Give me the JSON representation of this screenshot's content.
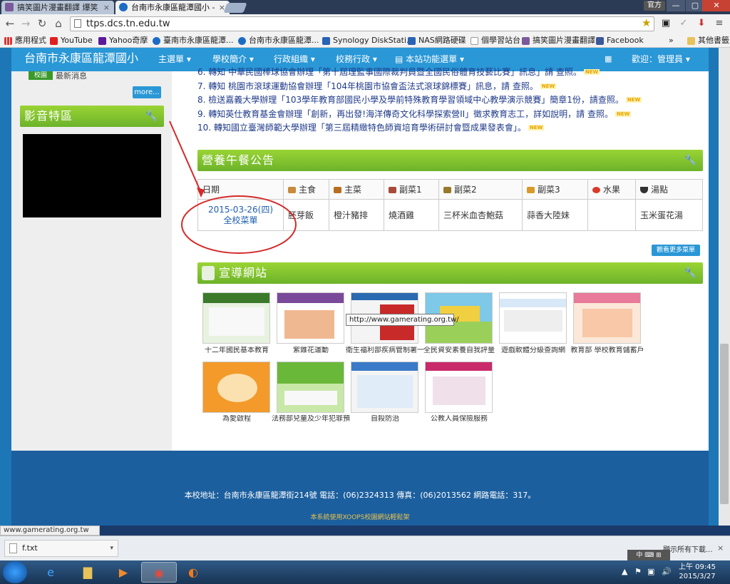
{
  "tabs": [
    {
      "label": "搞笑圖片漫畫翻譯 爆笑"
    },
    {
      "label": "台南市永康區龍潭國小 - "
    }
  ],
  "user_label": "官方",
  "url": "ttps.dcs.tn.edu.tw",
  "bookmarks": [
    "應用程式",
    "YouTube",
    "Yahoo奇摩",
    "臺南市永康區龍潭...",
    "台南市永康區龍潭...",
    "Synology DiskStati...",
    "NAS網路硬碟",
    "個學習站台",
    "搞笑圖片漫畫翻譯",
    "Facebook"
  ],
  "bookmarks_more": "»",
  "bookmarks_other": "其他書籤",
  "site": {
    "title": "台南市永康區龍潭國小",
    "nav": [
      "主選單 ▾",
      "學校簡介 ▾",
      "行政組織 ▾",
      "校務行政 ▾",
      "本站功能選單 ▾"
    ],
    "welcome": "歡迎：管理員 ▾"
  },
  "sidebar": {
    "news_badge": "校園",
    "news_text": "最新消息",
    "more": "more...",
    "video_title": "影音特區"
  },
  "news": [
    {
      "num": "6.",
      "text": "轉知 中華民國棒球協會辦理「第十屆理監事國際裁判員暨全國民俗體育技藝比賽」訊息」請 查照。",
      "new": true
    },
    {
      "num": "7.",
      "text": "轉知 桃園市滾球運動協會辦理「104年桃園市協會盃法式滾球錦標賽」訊息，請 查照。",
      "new": true
    },
    {
      "num": "8.",
      "text": "檢送嘉義大學辦理「103學年教育部國民小學及學前特殊教育學習領域中心教學演示競賽」簡章1份，請查照。",
      "new": true
    },
    {
      "num": "9.",
      "text": "轉知英仕教育基金會辦理「創新，再出發!海洋傳奇文化科學探索營II」徵求教育志工，詳如說明，請 查照。",
      "new": true
    },
    {
      "num": "10.",
      "text": "轉知國立臺灣師範大學辦理「第三屆精緻特色師資培育學術研討會暨成果發表會」。",
      "new": true
    }
  ],
  "lunch": {
    "title": "營養午餐公告",
    "headers": [
      "日期",
      "主食",
      "主菜",
      "副菜1",
      "副菜2",
      "副菜3",
      "水果",
      "湯點"
    ],
    "date": "2015-03-26(四)",
    "menu_link": "全校菜單",
    "items": [
      "胚芽飯",
      "橙汁豬排",
      "燒酒雞",
      "三杯米血杏鮑菇",
      "蒜香大陸妹",
      "",
      "玉米蛋花湯"
    ],
    "more": "觀看更多菜單"
  },
  "guide": {
    "title": "宣導網站",
    "sites": [
      {
        "label": "十二年國民基本教育"
      },
      {
        "label": "紫錐花運動"
      },
      {
        "label": "衛生福利部疾病管制署一般民眾版"
      },
      {
        "label": "全民資安素養自我評量"
      },
      {
        "label": "遊戲軟體分級查詢網"
      },
      {
        "label": "教育部 學校教育儲蓄戶"
      },
      {
        "label": "為愛啟程"
      },
      {
        "label": "法務部兒童及少年犯罪預防網"
      },
      {
        "label": "自殺防治"
      },
      {
        "label": "公教人員保險服務"
      }
    ],
    "tooltip": "http://www.gamerating.org.tw/"
  },
  "footer": {
    "address": "本校地址：台南市永康區龍潭街214號 電話：(06)2324313 傳真：(06)2013562 網路電話：317。",
    "powered": "本系統使用XOOPS校園網站輕鬆架"
  },
  "status_url": "www.gamerating.org.tw",
  "download": {
    "file": "f.txt",
    "show_all": "顯示所有下載...",
    "close": "×"
  },
  "ime": "中 ⌨ ⊞",
  "clock": {
    "time": "上午 09:45",
    "date": "2015/3/27"
  },
  "colors": {
    "nav_blue": "#2a97d6",
    "section_green": "#7fc130",
    "link_blue": "#1f3a8a",
    "annotation_red": "#d42a2a"
  }
}
